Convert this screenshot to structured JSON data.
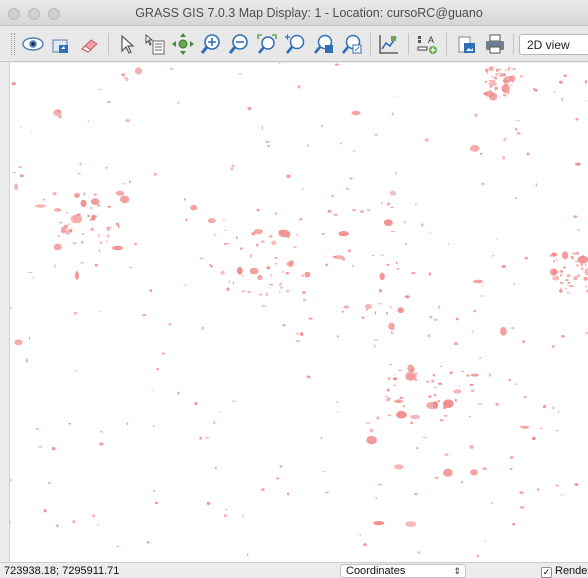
{
  "window": {
    "title": "GRASS GIS 7.0.3 Map Display: 1  - Location: cursoRC@guano"
  },
  "toolbar": {
    "buttons": [
      {
        "name": "display-map-button",
        "icon": "eye-icon"
      },
      {
        "name": "render-map-button",
        "icon": "render-icon"
      },
      {
        "name": "erase-display-button",
        "icon": "eraser-icon"
      },
      {
        "name": "pointer-button",
        "icon": "arrow-pointer-icon"
      },
      {
        "name": "query-button",
        "icon": "query-icon"
      },
      {
        "name": "pan-button",
        "icon": "pan-icon"
      },
      {
        "name": "zoom-in-button",
        "icon": "zoom-in-icon"
      },
      {
        "name": "zoom-out-button",
        "icon": "zoom-out-icon"
      },
      {
        "name": "zoom-extent-button",
        "icon": "zoom-extent-icon"
      },
      {
        "name": "zoom-back-button",
        "icon": "zoom-back-icon"
      },
      {
        "name": "zoom-options-button",
        "icon": "zoom-menu-icon"
      },
      {
        "name": "zoom-region-button",
        "icon": "zoom-region-icon"
      },
      {
        "name": "analyze-button",
        "icon": "analyze-icon"
      },
      {
        "name": "decorations-button",
        "icon": "decorations-icon"
      },
      {
        "name": "save-image-button",
        "icon": "save-image-icon"
      },
      {
        "name": "print-button",
        "icon": "print-icon"
      }
    ],
    "view_mode": "2D view"
  },
  "map": {
    "background": "#ffffff",
    "raster_color": "#f08a8a"
  },
  "statusbar": {
    "coordinates": "723938.18; 7295911.71",
    "mode": "Coordinates",
    "render_label": "Render",
    "render_checked": true
  },
  "colors": {
    "chrome": "#ececec",
    "toolbar": "#e8e8e8",
    "accent_blue": "#2e6fb7"
  }
}
